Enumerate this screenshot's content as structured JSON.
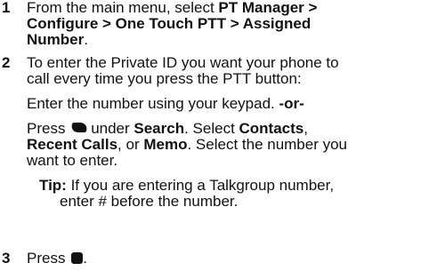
{
  "steps": [
    {
      "number": "1",
      "line1_pre": "From the main menu, select ",
      "line1_bold": "PT Manager >",
      "line2_bold": "Configure > One Touch PTT > Assigned",
      "line3_bold": "Number",
      "line3_post": "."
    },
    {
      "number": "2",
      "line1": "To enter the Private ID you want your phone to",
      "line2": "call every time you press the PTT button:",
      "option1": "Enter the number using your keypad. ",
      "option1_or": "-or-",
      "press_pre": "Press ",
      "press_under": "under ",
      "search_label": "Search",
      "select_text": ". Select ",
      "contacts_label": "Contacts",
      "comma": ",",
      "recent_calls_label": "Recent Calls",
      "or_text": ", or ",
      "memo_label": "Memo",
      "select_number_text": ". Select the number you",
      "want_text": "want to enter.",
      "tip_label": "Tip:",
      "tip_text": " If you are entering a Talkgroup number,",
      "tip_cont": "enter # before the number."
    },
    {
      "number": "3",
      "press_text": "Press ",
      "period": "."
    }
  ],
  "icons": {
    "softkey": "left-softkey-icon",
    "ok": "ok-key-icon"
  }
}
